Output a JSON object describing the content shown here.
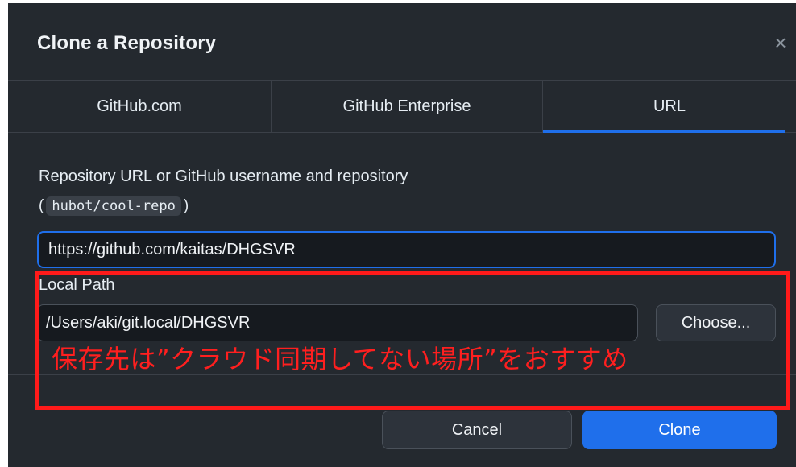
{
  "dialog": {
    "title": "Clone a Repository",
    "close_icon": "×"
  },
  "tabs": [
    {
      "label": "GitHub.com",
      "active": false
    },
    {
      "label": "GitHub Enterprise",
      "active": false
    },
    {
      "label": "URL",
      "active": true
    }
  ],
  "url_section": {
    "label": "Repository URL or GitHub username and repository",
    "hint_open": "(",
    "hint_code": "hubot/cool-repo",
    "hint_close": ")",
    "value": "https://github.com/kaitas/DHGSVR"
  },
  "local_path": {
    "label": "Local Path",
    "value": "/Users/aki/git.local/DHGSVR",
    "choose_label": "Choose..."
  },
  "footer": {
    "cancel_label": "Cancel",
    "clone_label": "Clone"
  },
  "annotation": {
    "text": "保存先は”クラウド同期してない場所”をおすすめ",
    "color": "#ff1f1f"
  },
  "colors": {
    "background": "#24292f",
    "accent": "#1f6feb"
  }
}
